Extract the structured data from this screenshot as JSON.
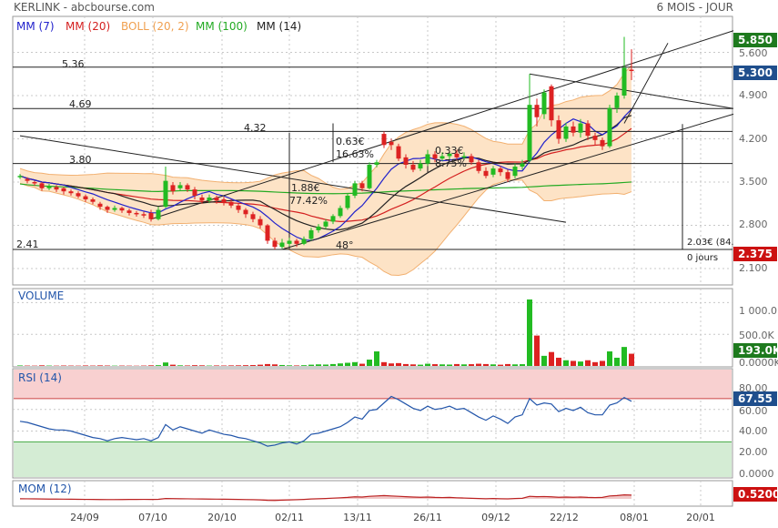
{
  "header": {
    "title": "KERLINK - abcbourse.com",
    "period": "6 MOIS - JOUR",
    "legend": [
      {
        "label": "MM (7)",
        "color": "#2222cc"
      },
      {
        "label": "MM (20)",
        "color": "#d42020"
      },
      {
        "label": "BOLL (20, 2)",
        "color": "#f0a050"
      },
      {
        "label": "MM (100)",
        "color": "#22aa22"
      },
      {
        "label": "MM (14)",
        "color": "#222222"
      }
    ]
  },
  "colors": {
    "up": "#22bb22",
    "down": "#dd2222",
    "boll_fill": "#fde3c6",
    "boll_line": "#f2b070",
    "mm7": "#2222cc",
    "mm20": "#d42020",
    "mm100": "#22aa22",
    "mm14": "#222222",
    "rsi_line": "#2255aa",
    "rsi_over": "#f8d0d0",
    "rsi_under": "#d4ecd4",
    "mom_line": "#bb2222",
    "grid": "#c8c8c8",
    "badge_green": "#1e7a1e",
    "badge_red": "#cc1111",
    "badge_blue": "#1f4e8c"
  },
  "panels": {
    "volume": "VOLUME",
    "rsi": "RSI (14)",
    "mom": "MOM (12)"
  },
  "price_axis": {
    "ticks": [
      "5.600",
      "4.900",
      "4.200",
      "3.500",
      "2.800",
      "2.100"
    ],
    "current_high": "5.850",
    "current_last": "5.300",
    "current_low": "2.375"
  },
  "volume_axis": {
    "ticks": [
      "1 000.0K",
      "500.0K",
      "0.0000K"
    ],
    "current": "193.0K"
  },
  "rsi_axis": {
    "ticks": [
      "80.00",
      "60.00",
      "40.00",
      "20.00",
      "0.0000"
    ],
    "current": "67.55"
  },
  "mom_axis": {
    "current": "0.5200"
  },
  "x_axis": {
    "ticks": [
      "24/09",
      "07/10",
      "20/10",
      "02/11",
      "13/11",
      "26/11",
      "09/12",
      "22/12",
      "08/01",
      "20/01"
    ]
  },
  "annotations": {
    "level_536": "5.36",
    "level_469": "4.69",
    "level_432": "4.32",
    "level_380": "3.80",
    "level_241": "2.41",
    "move1_value": "1.88€",
    "move1_pct": "77.42%",
    "angle": "48°",
    "move2_value": "0.63€",
    "move2_pct": "16.63%",
    "move3_value": "0.33€",
    "move3_pct": "8.75%",
    "measure_value": "2.03€ (84.",
    "measure_days": "0 jours"
  },
  "chart_data": {
    "type": "candlestick",
    "title": "KERLINK - abcbourse.com",
    "period": "6 MOIS - JOUR",
    "x_tick_labels": [
      "24/09",
      "07/10",
      "20/10",
      "02/11",
      "13/11",
      "26/11",
      "09/12",
      "22/12",
      "08/01",
      "20/01"
    ],
    "price_range": [
      2.0,
      5.9
    ],
    "horizontal_levels": [
      5.36,
      4.69,
      4.32,
      3.8,
      2.41
    ],
    "candles": [
      {
        "o": 3.58,
        "c": 3.6,
        "h": 3.63,
        "l": 3.55
      },
      {
        "o": 3.55,
        "c": 3.52,
        "h": 3.58,
        "l": 3.48
      },
      {
        "o": 3.5,
        "c": 3.48,
        "h": 3.52,
        "l": 3.44
      },
      {
        "o": 3.48,
        "c": 3.4,
        "h": 3.5,
        "l": 3.36
      },
      {
        "o": 3.4,
        "c": 3.44,
        "h": 3.47,
        "l": 3.37
      },
      {
        "o": 3.42,
        "c": 3.38,
        "h": 3.45,
        "l": 3.34
      },
      {
        "o": 3.4,
        "c": 3.35,
        "h": 3.42,
        "l": 3.3
      },
      {
        "o": 3.35,
        "c": 3.32,
        "h": 3.38,
        "l": 3.28
      },
      {
        "o": 3.32,
        "c": 3.27,
        "h": 3.35,
        "l": 3.24
      },
      {
        "o": 3.27,
        "c": 3.22,
        "h": 3.3,
        "l": 3.18
      },
      {
        "o": 3.22,
        "c": 3.18,
        "h": 3.25,
        "l": 3.14
      },
      {
        "o": 3.15,
        "c": 3.1,
        "h": 3.18,
        "l": 3.05
      },
      {
        "o": 3.1,
        "c": 3.05,
        "h": 3.12,
        "l": 3.0
      },
      {
        "o": 3.05,
        "c": 3.08,
        "h": 3.12,
        "l": 3.02
      },
      {
        "o": 3.08,
        "c": 3.04,
        "h": 3.1,
        "l": 3.0
      },
      {
        "o": 3.04,
        "c": 3.0,
        "h": 3.07,
        "l": 2.96
      },
      {
        "o": 3.0,
        "c": 2.98,
        "h": 3.03,
        "l": 2.94
      },
      {
        "o": 2.98,
        "c": 2.96,
        "h": 3.02,
        "l": 2.92
      },
      {
        "o": 3.0,
        "c": 2.9,
        "h": 3.05,
        "l": 2.86
      },
      {
        "o": 2.9,
        "c": 3.05,
        "h": 3.1,
        "l": 2.88
      },
      {
        "o": 3.1,
        "c": 3.52,
        "h": 3.75,
        "l": 3.08
      },
      {
        "o": 3.45,
        "c": 3.35,
        "h": 3.5,
        "l": 3.3
      },
      {
        "o": 3.4,
        "c": 3.45,
        "h": 3.5,
        "l": 3.36
      },
      {
        "o": 3.45,
        "c": 3.38,
        "h": 3.48,
        "l": 3.34
      },
      {
        "o": 3.38,
        "c": 3.28,
        "h": 3.42,
        "l": 3.22
      },
      {
        "o": 3.25,
        "c": 3.2,
        "h": 3.3,
        "l": 3.15
      },
      {
        "o": 3.2,
        "c": 3.25,
        "h": 3.3,
        "l": 3.16
      },
      {
        "o": 3.25,
        "c": 3.2,
        "h": 3.28,
        "l": 3.15
      },
      {
        "o": 3.22,
        "c": 3.17,
        "h": 3.26,
        "l": 3.12
      },
      {
        "o": 3.18,
        "c": 3.12,
        "h": 3.22,
        "l": 3.08
      },
      {
        "o": 3.12,
        "c": 3.05,
        "h": 3.16,
        "l": 3.0
      },
      {
        "o": 3.05,
        "c": 2.98,
        "h": 3.08,
        "l": 2.92
      },
      {
        "o": 2.98,
        "c": 2.9,
        "h": 3.02,
        "l": 2.85
      },
      {
        "o": 2.9,
        "c": 2.8,
        "h": 2.95,
        "l": 2.75
      },
      {
        "o": 2.8,
        "c": 2.55,
        "h": 2.82,
        "l": 2.5
      },
      {
        "o": 2.55,
        "c": 2.45,
        "h": 2.6,
        "l": 2.41
      },
      {
        "o": 2.45,
        "c": 2.52,
        "h": 2.58,
        "l": 2.42
      },
      {
        "o": 2.5,
        "c": 2.55,
        "h": 2.6,
        "l": 2.46
      },
      {
        "o": 2.55,
        "c": 2.5,
        "h": 2.58,
        "l": 2.45
      },
      {
        "o": 2.5,
        "c": 2.58,
        "h": 2.62,
        "l": 2.48
      },
      {
        "o": 2.58,
        "c": 2.72,
        "h": 2.76,
        "l": 2.55
      },
      {
        "o": 2.72,
        "c": 2.78,
        "h": 2.82,
        "l": 2.68
      },
      {
        "o": 2.78,
        "c": 2.86,
        "h": 2.9,
        "l": 2.74
      },
      {
        "o": 2.86,
        "c": 2.95,
        "h": 2.98,
        "l": 2.82
      },
      {
        "o": 2.95,
        "c": 3.08,
        "h": 3.12,
        "l": 2.92
      },
      {
        "o": 3.08,
        "c": 3.28,
        "h": 3.32,
        "l": 3.05
      },
      {
        "o": 3.28,
        "c": 3.48,
        "h": 3.52,
        "l": 3.24
      },
      {
        "o": 3.48,
        "c": 3.4,
        "h": 3.52,
        "l": 3.35
      },
      {
        "o": 3.4,
        "c": 3.78,
        "h": 3.82,
        "l": 3.38
      },
      {
        "o": 3.78,
        "c": 3.82,
        "h": 3.86,
        "l": 3.74
      },
      {
        "o": 4.28,
        "c": 4.1,
        "h": 4.32,
        "l": 4.05
      },
      {
        "o": 4.15,
        "c": 4.1,
        "h": 4.2,
        "l": 4.02
      },
      {
        "o": 4.08,
        "c": 3.88,
        "h": 4.12,
        "l": 3.84
      },
      {
        "o": 3.9,
        "c": 3.78,
        "h": 3.95,
        "l": 3.72
      },
      {
        "o": 3.78,
        "c": 3.7,
        "h": 3.84,
        "l": 3.66
      },
      {
        "o": 3.72,
        "c": 3.8,
        "h": 3.86,
        "l": 3.68
      },
      {
        "o": 3.8,
        "c": 3.95,
        "h": 4.02,
        "l": 3.76
      },
      {
        "o": 3.95,
        "c": 3.88,
        "h": 4.0,
        "l": 3.82
      },
      {
        "o": 3.88,
        "c": 3.92,
        "h": 3.98,
        "l": 3.84
      },
      {
        "o": 3.92,
        "c": 3.96,
        "h": 4.0,
        "l": 3.86
      },
      {
        "o": 3.96,
        "c": 3.9,
        "h": 4.02,
        "l": 3.86
      },
      {
        "o": 3.9,
        "c": 3.92,
        "h": 3.98,
        "l": 3.86
      },
      {
        "o": 3.92,
        "c": 3.82,
        "h": 3.96,
        "l": 3.78
      },
      {
        "o": 3.82,
        "c": 3.68,
        "h": 3.86,
        "l": 3.64
      },
      {
        "o": 3.68,
        "c": 3.6,
        "h": 3.74,
        "l": 3.56
      },
      {
        "o": 3.62,
        "c": 3.72,
        "h": 3.76,
        "l": 3.58
      },
      {
        "o": 3.72,
        "c": 3.66,
        "h": 3.76,
        "l": 3.6
      },
      {
        "o": 3.66,
        "c": 3.55,
        "h": 3.7,
        "l": 3.5
      },
      {
        "o": 3.6,
        "c": 3.75,
        "h": 3.8,
        "l": 3.56
      },
      {
        "o": 3.75,
        "c": 3.8,
        "h": 3.86,
        "l": 3.7
      },
      {
        "o": 3.85,
        "c": 4.75,
        "h": 5.25,
        "l": 3.82
      },
      {
        "o": 4.75,
        "c": 4.55,
        "h": 4.85,
        "l": 4.4
      },
      {
        "o": 4.6,
        "c": 4.95,
        "h": 5.0,
        "l": 4.52
      },
      {
        "o": 5.05,
        "c": 4.5,
        "h": 5.08,
        "l": 4.4
      },
      {
        "o": 4.5,
        "c": 4.2,
        "h": 4.58,
        "l": 4.12
      },
      {
        "o": 4.2,
        "c": 4.4,
        "h": 4.46,
        "l": 4.15
      },
      {
        "o": 4.4,
        "c": 4.3,
        "h": 4.48,
        "l": 4.24
      },
      {
        "o": 4.3,
        "c": 4.45,
        "h": 4.52,
        "l": 4.22
      },
      {
        "o": 4.45,
        "c": 4.25,
        "h": 4.5,
        "l": 4.18
      },
      {
        "o": 4.25,
        "c": 4.18,
        "h": 4.3,
        "l": 4.1
      },
      {
        "o": 4.18,
        "c": 4.08,
        "h": 4.22,
        "l": 4.02
      },
      {
        "o": 4.08,
        "c": 4.7,
        "h": 4.75,
        "l": 4.05
      },
      {
        "o": 4.7,
        "c": 4.9,
        "h": 4.95,
        "l": 4.62
      },
      {
        "o": 4.9,
        "c": 5.35,
        "h": 5.85,
        "l": 4.85
      },
      {
        "o": 5.32,
        "c": 5.3,
        "h": 5.65,
        "l": 5.15
      }
    ],
    "volume_k": [
      8,
      6,
      5,
      10,
      6,
      5,
      7,
      6,
      5,
      8,
      6,
      9,
      7,
      5,
      6,
      5,
      4,
      6,
      10,
      12,
      55,
      20,
      10,
      8,
      12,
      10,
      6,
      8,
      7,
      9,
      10,
      12,
      14,
      20,
      30,
      25,
      15,
      10,
      8,
      12,
      20,
      25,
      22,
      30,
      40,
      50,
      60,
      35,
      100,
      230,
      60,
      40,
      45,
      30,
      25,
      20,
      35,
      28,
      25,
      22,
      30,
      25,
      28,
      35,
      30,
      25,
      20,
      30,
      25,
      28,
      1050,
      480,
      160,
      220,
      130,
      90,
      80,
      70,
      90,
      60,
      80,
      230,
      130,
      300,
      193
    ],
    "rsi": [
      49,
      48,
      46,
      44,
      42,
      41,
      41,
      40,
      38,
      36,
      34,
      33,
      31,
      33,
      34,
      33,
      32,
      33,
      31,
      34,
      46,
      41,
      44,
      42,
      40,
      38,
      41,
      39,
      37,
      36,
      34,
      33,
      31,
      29,
      26,
      27,
      29,
      30,
      28,
      31,
      37,
      38,
      40,
      42,
      44,
      48,
      53,
      51,
      59,
      60,
      66,
      72,
      69,
      65,
      61,
      59,
      63,
      60,
      61,
      63,
      60,
      61,
      57,
      53,
      50,
      54,
      51,
      47,
      53,
      55,
      70,
      64,
      66,
      65,
      58,
      61,
      59,
      62,
      57,
      55,
      55,
      64,
      66,
      71,
      67.55
    ],
    "rsi_bands": [
      30,
      70
    ],
    "mom": [
      0.02,
      0.01,
      0.0,
      -0.02,
      -0.03,
      -0.03,
      -0.04,
      -0.05,
      -0.06,
      -0.07,
      -0.08,
      -0.09,
      -0.1,
      -0.1,
      -0.09,
      -0.08,
      -0.08,
      -0.07,
      -0.08,
      -0.06,
      0.05,
      0.03,
      0.02,
      0.01,
      -0.01,
      -0.02,
      -0.03,
      -0.04,
      -0.05,
      -0.06,
      -0.08,
      -0.1,
      -0.12,
      -0.15,
      -0.2,
      -0.22,
      -0.18,
      -0.15,
      -0.12,
      -0.08,
      -0.02,
      0.02,
      0.05,
      0.1,
      0.15,
      0.2,
      0.28,
      0.25,
      0.35,
      0.4,
      0.45,
      0.4,
      0.35,
      0.3,
      0.25,
      0.22,
      0.25,
      0.2,
      0.18,
      0.2,
      0.15,
      0.12,
      0.08,
      0.05,
      0.02,
      0.05,
      0.02,
      0.0,
      0.05,
      0.08,
      0.35,
      0.3,
      0.32,
      0.28,
      0.22,
      0.25,
      0.22,
      0.25,
      0.2,
      0.18,
      0.2,
      0.4,
      0.45,
      0.55,
      0.52
    ]
  }
}
